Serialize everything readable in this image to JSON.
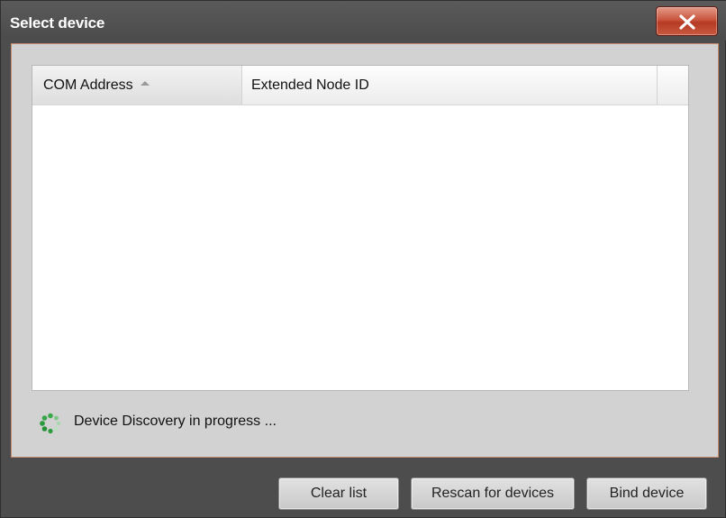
{
  "window": {
    "title": "Select device",
    "close_icon": "close-x-icon"
  },
  "list": {
    "columns": [
      {
        "label": "COM Address",
        "sort": "ascending"
      },
      {
        "label": "Extended Node ID"
      },
      {
        "label": ""
      }
    ],
    "rows": []
  },
  "status": {
    "icon": "spinner-icon",
    "text": "Device Discovery in progress ..."
  },
  "buttons": {
    "clear": "Clear list",
    "rescan": "Rescan for devices",
    "bind": "Bind device"
  },
  "colors": {
    "titlebar": "#4d4d4d",
    "panel": "#d2d2d2",
    "close_button": "#c24a33",
    "spinner": "#39a84a"
  }
}
